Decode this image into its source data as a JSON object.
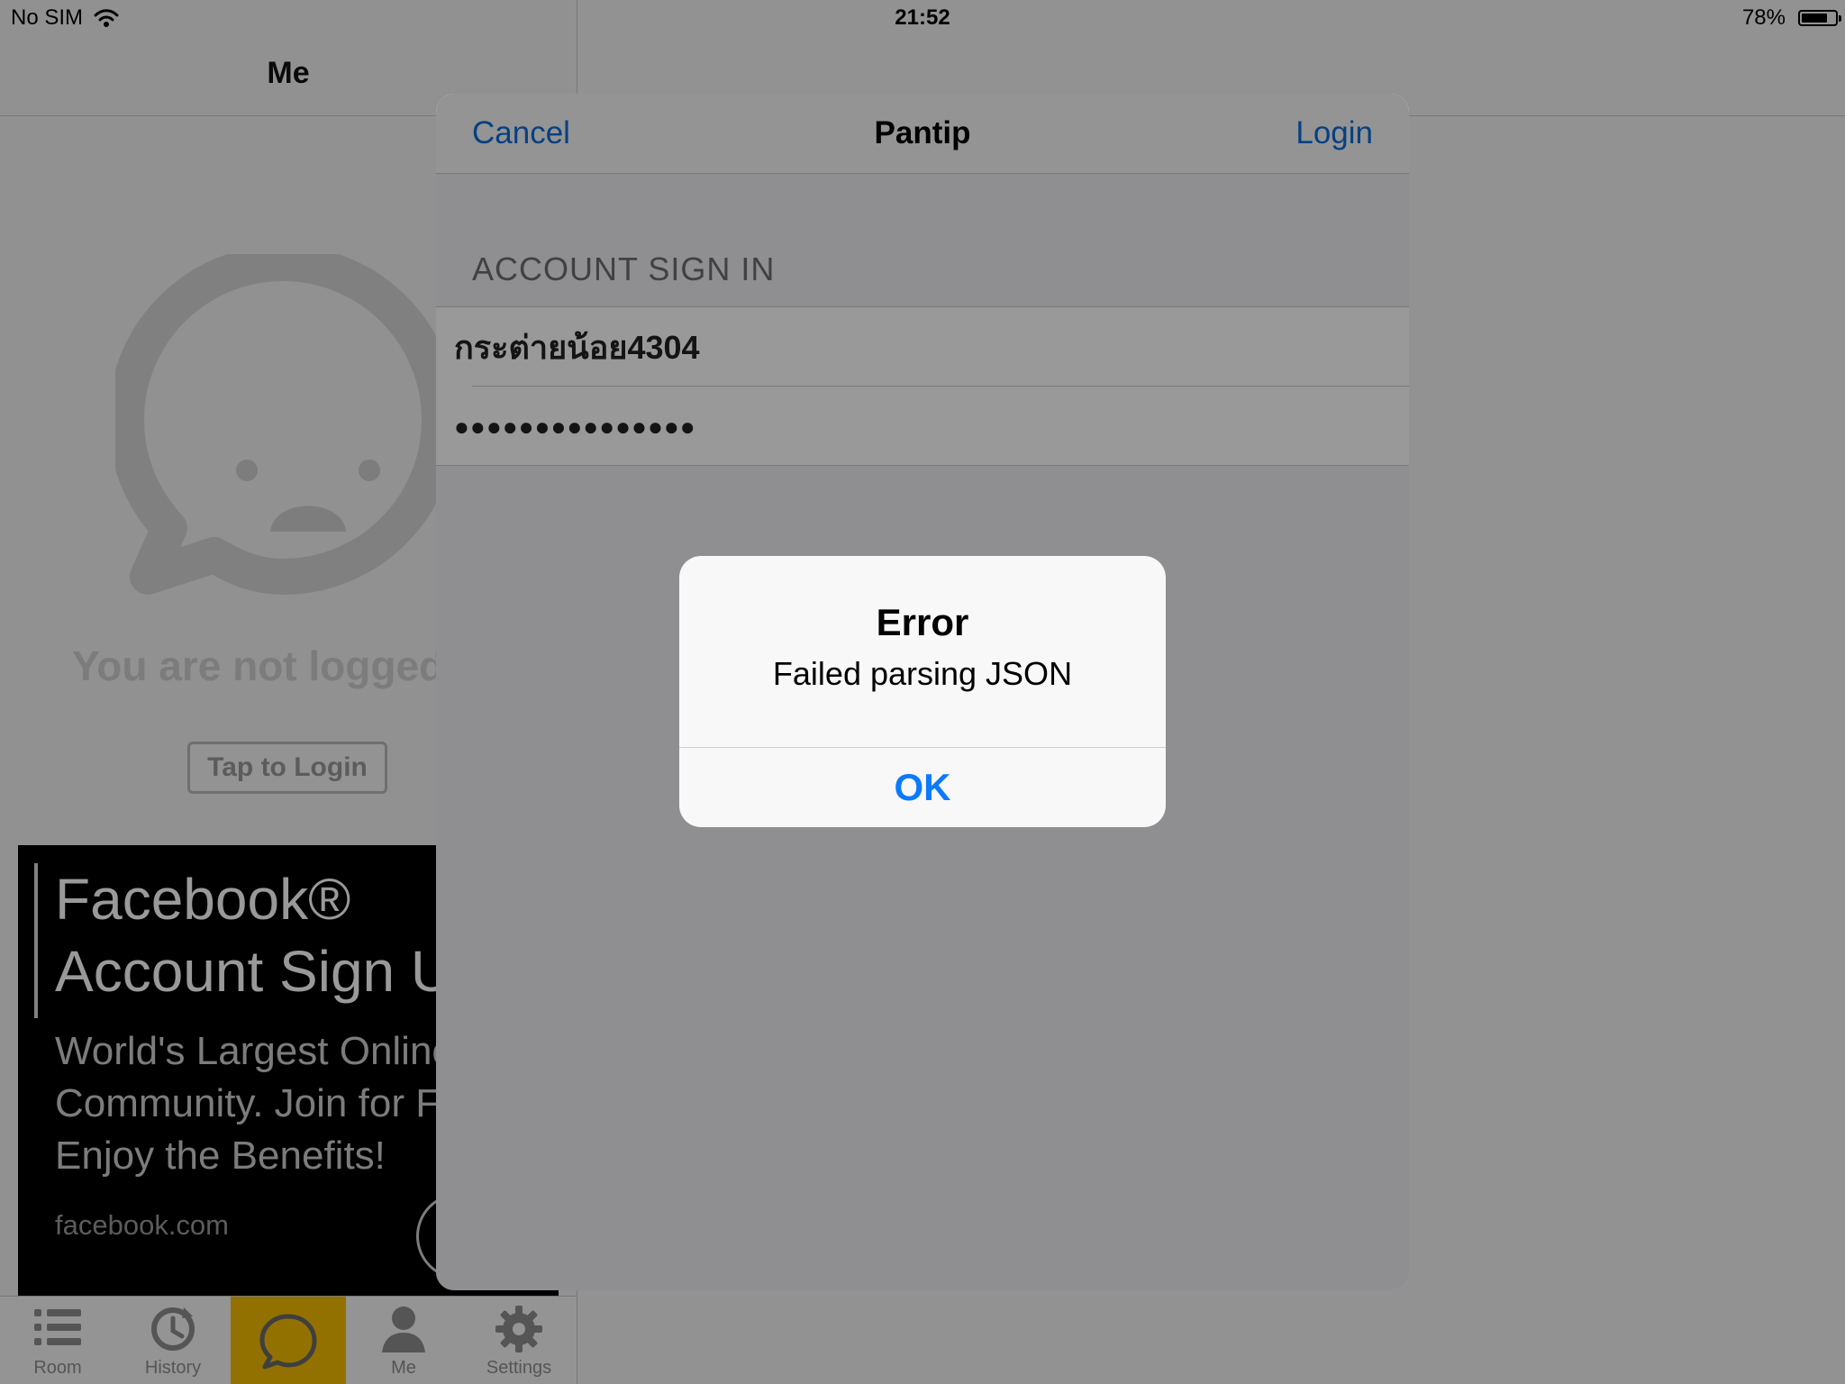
{
  "status_bar": {
    "carrier": "No SIM",
    "time": "21:52",
    "battery": "78%",
    "battery_level": 0.78
  },
  "master": {
    "title": "Me",
    "empty_state_text": "You are not logged in",
    "login_button": "Tap to Login",
    "ad": {
      "title_line1": "Facebook®",
      "title_line2": "Account Sign Up",
      "body_line1": "World's Largest Online",
      "body_line2": "Community. Join for Free",
      "body_line3": "Enjoy the Benefits!",
      "url": "facebook.com"
    },
    "tabs": [
      {
        "label": "Room",
        "icon": "list-icon"
      },
      {
        "label": "History",
        "icon": "history-icon"
      },
      {
        "label": "",
        "icon": "chat-bubble-icon",
        "selected": true
      },
      {
        "label": "Me",
        "icon": "person-icon"
      },
      {
        "label": "Settings",
        "icon": "gear-icon"
      }
    ],
    "selected_tab_color": "#f6bd00"
  },
  "sheet": {
    "cancel_label": "Cancel",
    "title": "Pantip",
    "login_label": "Login",
    "section_header": "ACCOUNT SIGN IN",
    "username_value": "กระต่ายน้อย4304",
    "password_value": "●●●●●●●●●●●●●●●",
    "accent_color": "#0d6bd8"
  },
  "alert": {
    "title": "Error",
    "message": "Failed parsing JSON",
    "ok_label": "OK",
    "ok_color": "#0a7aff"
  }
}
